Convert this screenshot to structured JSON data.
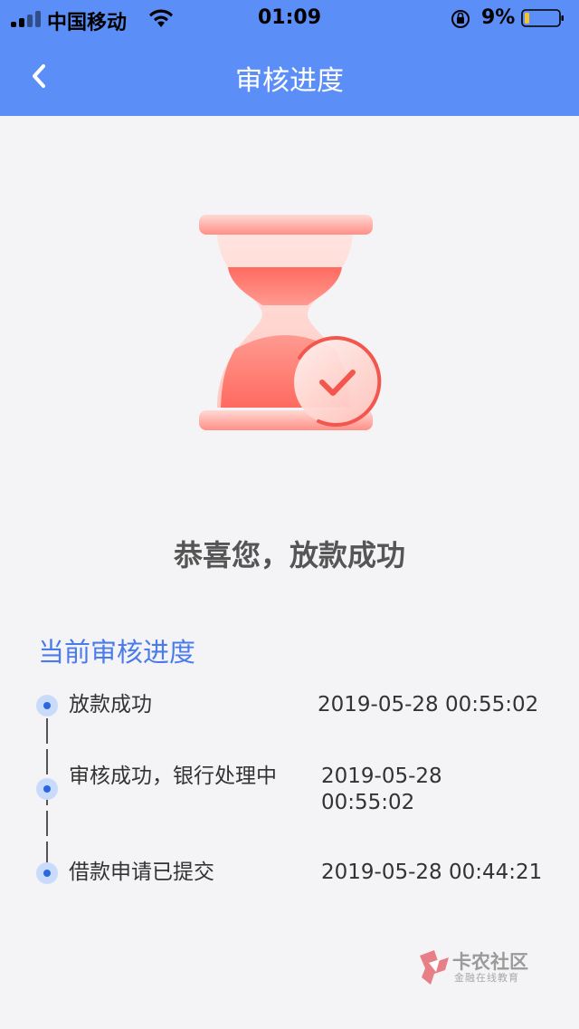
{
  "status_bar": {
    "carrier": "中国移动",
    "time": "01:09",
    "battery_percent": "9%"
  },
  "nav": {
    "title": "审核进度",
    "back_icon": "chevron-left-icon"
  },
  "hero": {
    "icon": "hourglass-check-icon",
    "message": "恭喜您，放款成功"
  },
  "progress": {
    "title": "当前审核进度",
    "steps": [
      {
        "label": "放款成功",
        "time": "2019-05-28 00:55:02"
      },
      {
        "label": "审核成功，银行处理中",
        "time": "2019-05-28 00:55:02"
      },
      {
        "label": "借款申请已提交",
        "time": "2019-05-28 00:44:21"
      }
    ]
  },
  "watermark": {
    "name": "卡农社区",
    "tagline": "金融在线教育"
  },
  "colors": {
    "accent": "#5b8ff7",
    "section_title": "#4a7bea",
    "timeline_dot": "#2e66de",
    "hourglass": "#ff6b63"
  }
}
